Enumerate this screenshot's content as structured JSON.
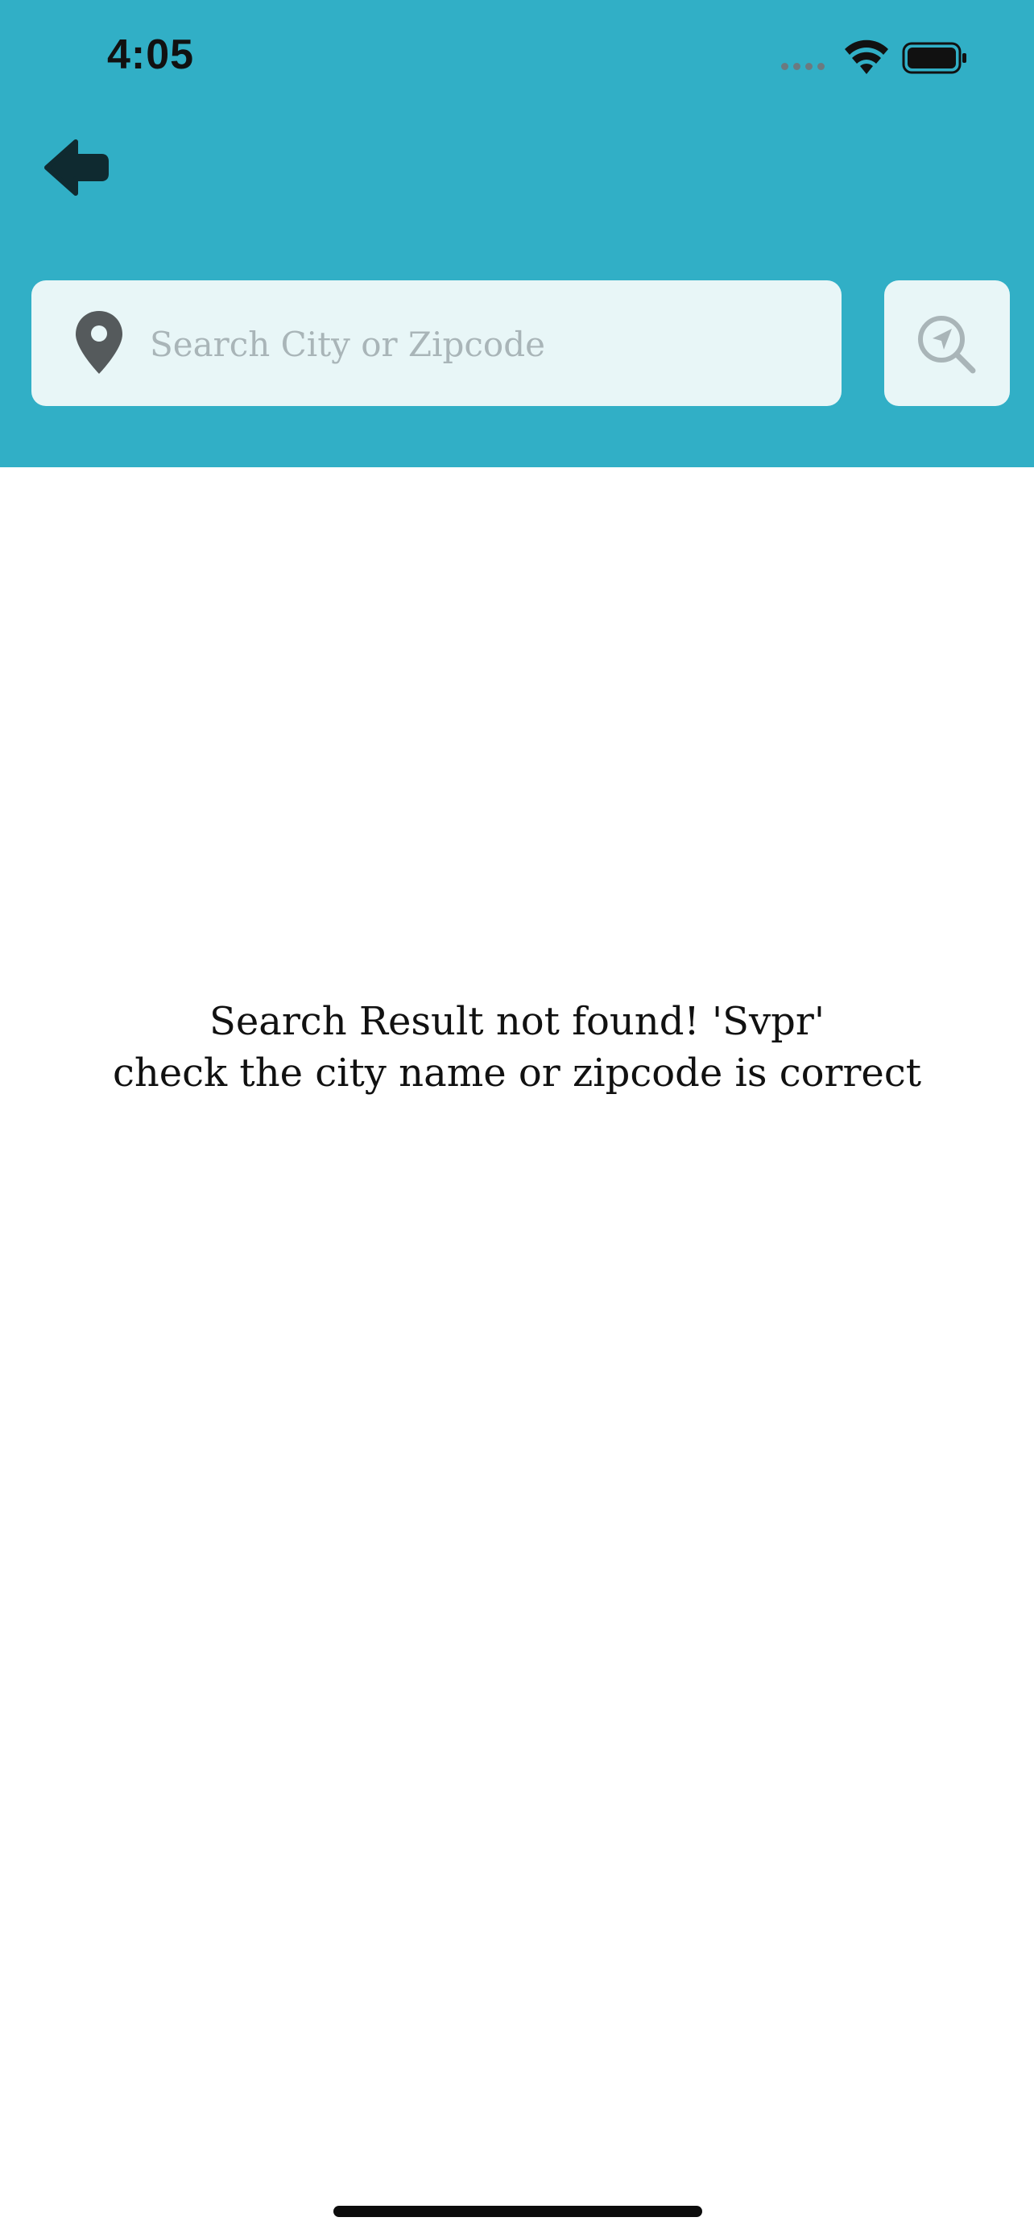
{
  "status_bar": {
    "time": "4:05",
    "icons": [
      "cellular-signal-icon",
      "wifi-icon",
      "battery-icon"
    ]
  },
  "header": {
    "background_color": "#31afc6",
    "back_icon": "arrow-left-icon"
  },
  "search": {
    "placeholder": "Search City or Zipcode",
    "value": "",
    "leading_icon": "map-pin-icon",
    "locate_icon": "location-search-icon"
  },
  "empty_state": {
    "line1": "Search Result not found! 'Svpr'",
    "line2": "check the city name or zipcode is correct"
  }
}
